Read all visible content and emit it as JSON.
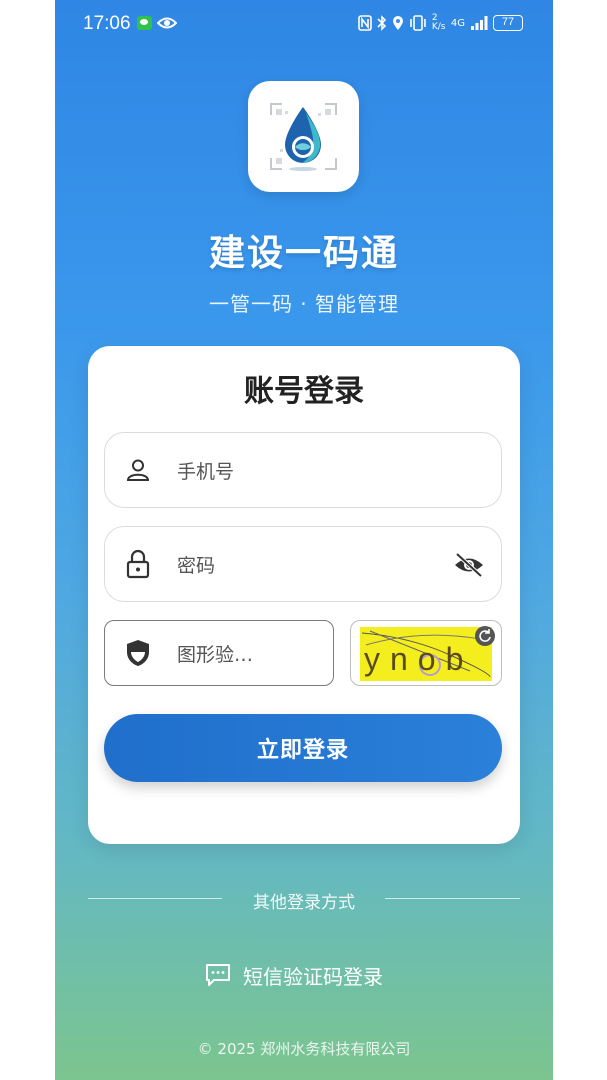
{
  "status_bar": {
    "time": "17:06",
    "net_speed": "2 K/s",
    "network": "4G",
    "battery": "77"
  },
  "app": {
    "title": "建设一码通",
    "subtitle": "一管一码 · 智能管理"
  },
  "login_card": {
    "title": "账号登录",
    "phone_placeholder": "手机号",
    "password_placeholder": "密码",
    "captcha_placeholder": "图形验…",
    "captcha_text": "ynob",
    "login_button": "立即登录"
  },
  "other_login": {
    "divider_text": "其他登录方式",
    "sms_login": "短信验证码登录"
  },
  "footer": {
    "copyright": "© 2025 郑州水务科技有限公司"
  },
  "colors": {
    "primary": "#1f6fcb",
    "gradient_top": "#2f86e4",
    "gradient_bottom": "#7cc58f",
    "captcha_bg": "#f5ee1e"
  }
}
